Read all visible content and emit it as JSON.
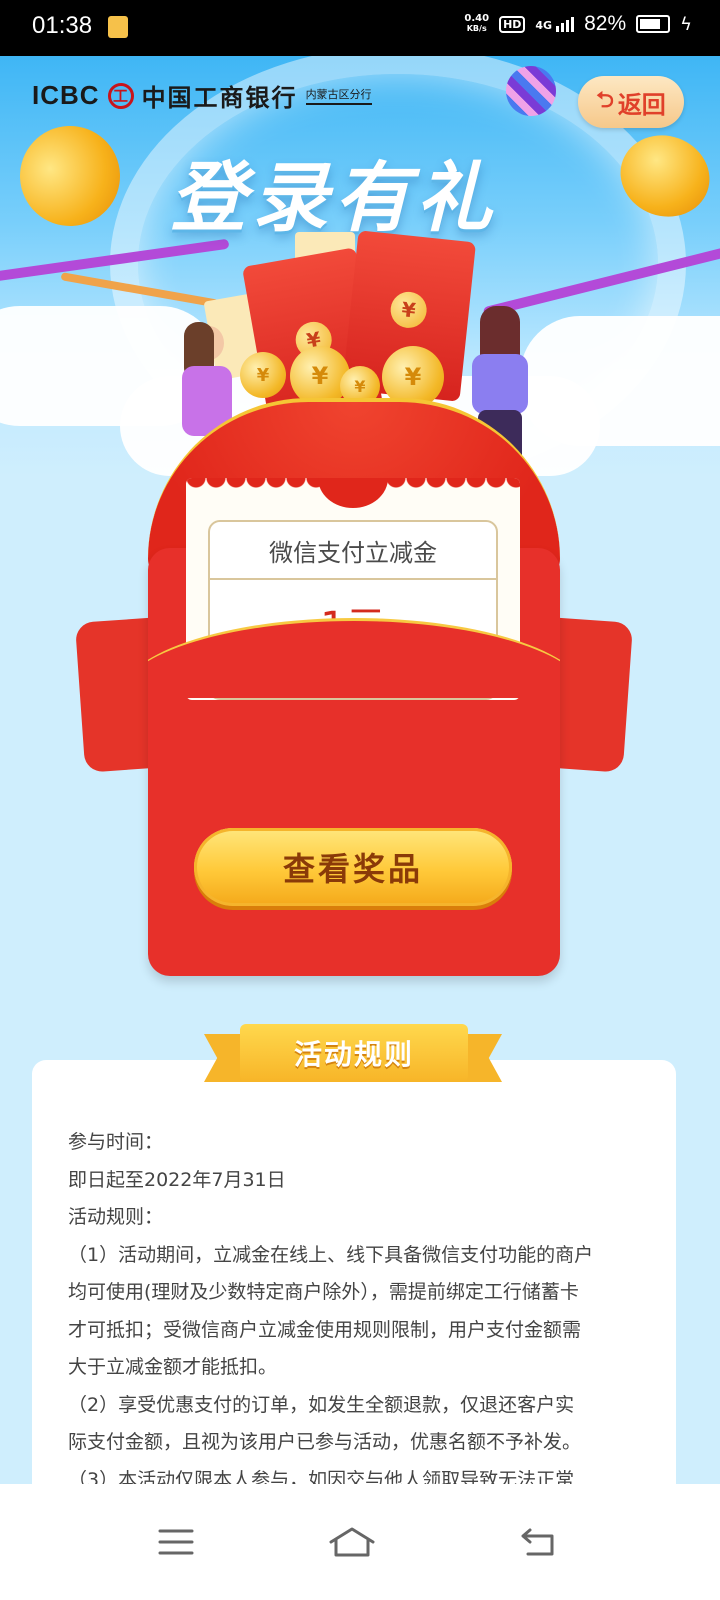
{
  "status_bar": {
    "time": "01:38",
    "speed_value": "0.40",
    "speed_unit": "KB/s",
    "hd": "HD",
    "network": "4G",
    "battery": "82%"
  },
  "header": {
    "logo_en": "ICBC",
    "logo_mark": "工",
    "logo_cn": "中国工商银行",
    "branch": "内蒙古区分行",
    "back_label": "返回",
    "back_icon": "back-arrow-icon"
  },
  "hero": {
    "title": "登录有礼"
  },
  "reward_card": {
    "name": "微信支付立减金",
    "amount": "1元"
  },
  "claim_button": {
    "label": "查看奖品"
  },
  "rules": {
    "title": "活动规则",
    "lines": [
      "参与时间：",
      "即日起至2022年7月31日",
      "活动规则：",
      "（1）活动期间，立减金在线上、线下具备微信支付功能的商户",
      "均可使用(理财及少数特定商户除外），需提前绑定工行储蓄卡",
      "才可抵扣；受微信商户立减金使用规则限制，用户支付金额需",
      "大于立减金额才能抵扣。",
      "（2）享受优惠支付的订单，如发生全额退款，仅退还客户实",
      "际支付金额，且视为该用户已参与活动，优惠名额不予补发。",
      "（3）本活动仅限本人参与，如因交与他人领取导致无法正常"
    ]
  },
  "nav": {
    "icons": [
      "menu-icon",
      "home-icon",
      "back-icon"
    ]
  },
  "colors": {
    "envelope_red": "#e7302a",
    "button_gold": "#ffc939",
    "sky_blue": "#3fb6f5"
  }
}
